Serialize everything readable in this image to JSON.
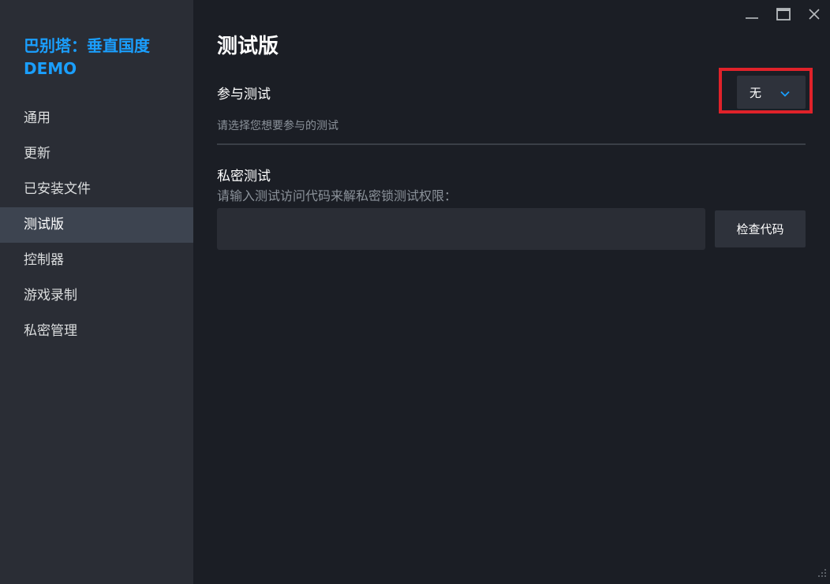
{
  "sidebar": {
    "game_title": "巴别塔：垂直国度 DEMO",
    "items": [
      {
        "label": "通用",
        "active": false
      },
      {
        "label": "更新",
        "active": false
      },
      {
        "label": "已安装文件",
        "active": false
      },
      {
        "label": "测试版",
        "active": true
      },
      {
        "label": "控制器",
        "active": false
      },
      {
        "label": "游戏录制",
        "active": false
      },
      {
        "label": "私密管理",
        "active": false
      }
    ]
  },
  "window_controls": {
    "icons": [
      "minimize-icon",
      "maximize-icon",
      "close-icon"
    ]
  },
  "main": {
    "title": "测试版",
    "participate": {
      "label": "参与测试",
      "description": "请选择您想要参与的测试",
      "dropdown_value": "无"
    },
    "private": {
      "label": "私密测试",
      "description": "请输入测试访问代码来解私密锁测试权限：",
      "input_value": "",
      "input_placeholder": "",
      "button_label": "检查代码"
    }
  },
  "colors": {
    "accent": "#1a9fff",
    "highlight": "#e0222a",
    "background": "#1b1e25",
    "sidebar": "#2a2d35"
  }
}
